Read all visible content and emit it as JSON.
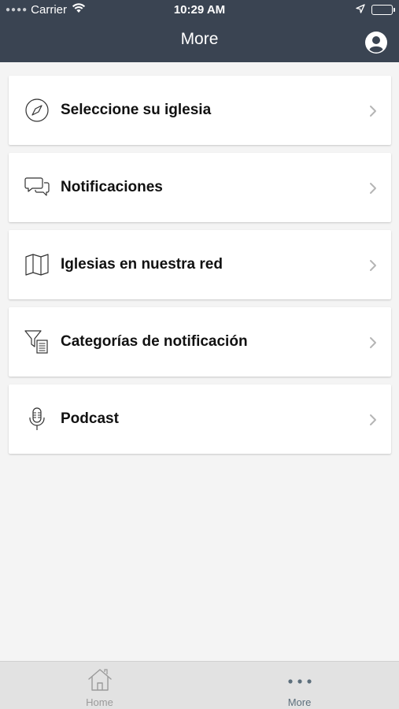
{
  "status_bar": {
    "carrier": "Carrier",
    "time": "10:29 AM"
  },
  "nav": {
    "title": "More",
    "profile_icon": "person-circle-icon"
  },
  "menu": [
    {
      "label": "Seleccione su iglesia",
      "icon": "compass-icon"
    },
    {
      "label": "Notificaciones",
      "icon": "chat-bubbles-icon"
    },
    {
      "label": "Iglesias en nuestra red",
      "icon": "map-icon"
    },
    {
      "label": "Categorías de notificación",
      "icon": "filter-list-icon"
    },
    {
      "label": "Podcast",
      "icon": "microphone-icon"
    }
  ],
  "tabbar": {
    "home_label": "Home",
    "more_label": "More",
    "active_color": "#5d6f7c",
    "inactive_color": "#9a9a9a"
  },
  "colors": {
    "header_bg": "#3a4452",
    "page_bg": "#f4f4f4"
  }
}
